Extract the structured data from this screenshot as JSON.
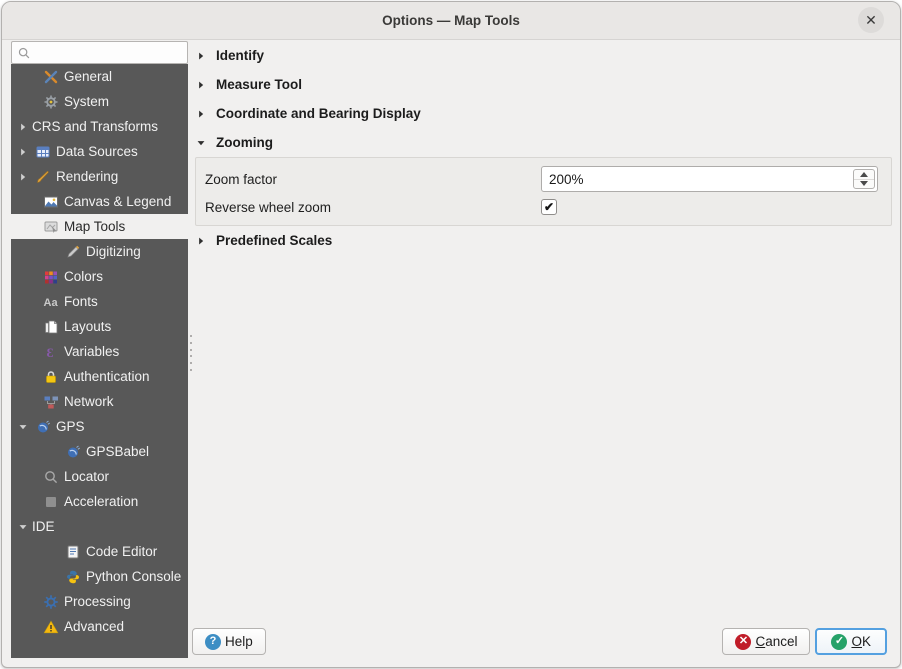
{
  "window": {
    "title": "Options — Map Tools",
    "close_glyph": "✕"
  },
  "sidebar": {
    "search_placeholder": "",
    "items": [
      {
        "label": "General",
        "icon": "general",
        "level": 0,
        "expander": null,
        "selected": false
      },
      {
        "label": "System",
        "icon": "system",
        "level": 0,
        "expander": null,
        "selected": false
      },
      {
        "label": "CRS and Transforms",
        "icon": null,
        "level": 0,
        "expander": "collapsed",
        "selected": false
      },
      {
        "label": "Data Sources",
        "icon": "data-sources",
        "level": 0,
        "expander": "collapsed",
        "selected": false
      },
      {
        "label": "Rendering",
        "icon": "rendering",
        "level": 0,
        "expander": "collapsed",
        "selected": false
      },
      {
        "label": "Canvas & Legend",
        "icon": "canvas-legend",
        "level": 0,
        "expander": null,
        "selected": false
      },
      {
        "label": "Map Tools",
        "icon": "map-tools",
        "level": 0,
        "expander": null,
        "selected": true
      },
      {
        "label": "Digitizing",
        "icon": "digitizing",
        "level": 1,
        "expander": null,
        "selected": false
      },
      {
        "label": "Colors",
        "icon": "colors",
        "level": 0,
        "expander": null,
        "selected": false
      },
      {
        "label": "Fonts",
        "icon": "fonts",
        "level": 0,
        "expander": null,
        "selected": false
      },
      {
        "label": "Layouts",
        "icon": "layouts",
        "level": 0,
        "expander": null,
        "selected": false
      },
      {
        "label": "Variables",
        "icon": "variables",
        "level": 0,
        "expander": null,
        "selected": false
      },
      {
        "label": "Authentication",
        "icon": "authentication",
        "level": 0,
        "expander": null,
        "selected": false
      },
      {
        "label": "Network",
        "icon": "network",
        "level": 0,
        "expander": null,
        "selected": false
      },
      {
        "label": "GPS",
        "icon": "gps",
        "level": 0,
        "expander": "expanded",
        "selected": false
      },
      {
        "label": "GPSBabel",
        "icon": "gpsbabel",
        "level": 1,
        "expander": null,
        "selected": false
      },
      {
        "label": "Locator",
        "icon": "locator",
        "level": 0,
        "expander": null,
        "selected": false
      },
      {
        "label": "Acceleration",
        "icon": "acceleration",
        "level": 0,
        "expander": null,
        "selected": false
      },
      {
        "label": "IDE",
        "icon": null,
        "level": 0,
        "expander": "expanded",
        "selected": false
      },
      {
        "label": "Code Editor",
        "icon": "code-editor",
        "level": 1,
        "expander": null,
        "selected": false
      },
      {
        "label": "Python Console",
        "icon": "python-console",
        "level": 1,
        "expander": null,
        "selected": false
      },
      {
        "label": "Processing",
        "icon": "processing",
        "level": 0,
        "expander": null,
        "selected": false
      },
      {
        "label": "Advanced",
        "icon": "advanced",
        "level": 0,
        "expander": null,
        "selected": false
      }
    ]
  },
  "main": {
    "sections": [
      {
        "id": "identify",
        "label": "Identify",
        "state": "collapsed"
      },
      {
        "id": "measure-tool",
        "label": "Measure Tool",
        "state": "collapsed"
      },
      {
        "id": "coordinate-bearing",
        "label": "Coordinate and Bearing Display",
        "state": "collapsed"
      },
      {
        "id": "zooming",
        "label": "Zooming",
        "state": "expanded"
      },
      {
        "id": "predefined-scales",
        "label": "Predefined Scales",
        "state": "collapsed"
      }
    ],
    "zooming": {
      "zoom_factor_label": "Zoom factor",
      "zoom_factor_value": "200%",
      "reverse_wheel_label": "Reverse wheel zoom",
      "reverse_wheel_checked": true
    }
  },
  "footer": {
    "help": {
      "label": "Help",
      "mnemonic": null
    },
    "cancel": {
      "label": "Cancel",
      "mnemonic": "C"
    },
    "ok": {
      "label": "OK",
      "mnemonic": "O"
    }
  },
  "colors": {
    "sidebar_bg": "#585858",
    "selected_bg": "#f1f0ef",
    "accent_focus": "#54a0e0",
    "ok_green": "#26a269",
    "cancel_red": "#c01c28",
    "help_blue": "#3d8ec4"
  }
}
